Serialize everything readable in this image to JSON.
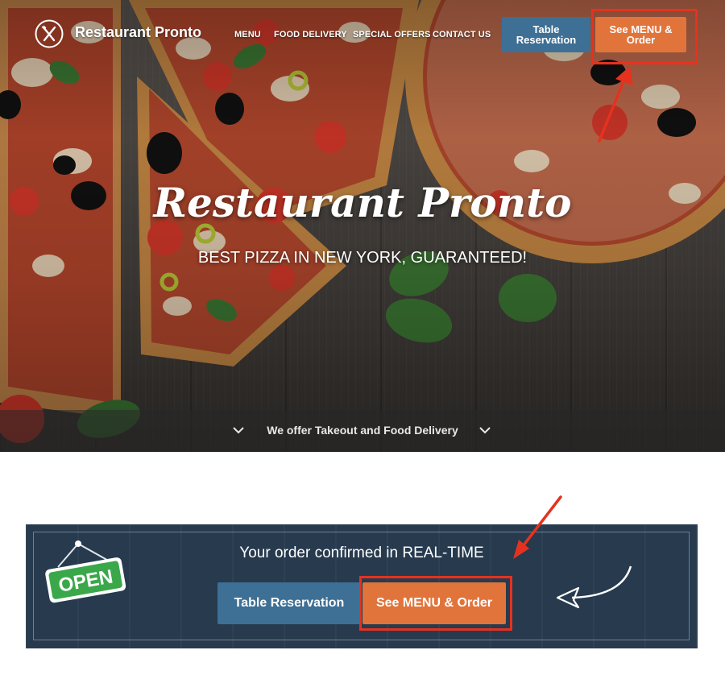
{
  "header": {
    "brand": "Restaurant Pronto",
    "nav": [
      "MENU",
      "FOOD DELIVERY",
      "SPECIAL OFFERS",
      "CONTACT US"
    ],
    "reservation_button": "Table Reservation",
    "menu_button": "See MENU & Order"
  },
  "hero": {
    "title": "Restaurant Pronto",
    "subtitle": "BEST PIZZA IN NEW YORK, GUARANTEED!",
    "info_bar": "We offer Takeout and Food Delivery"
  },
  "promo": {
    "title": "Your order confirmed in REAL-TIME",
    "sign_text": "OPEN",
    "reservation_button": "Table Reservation",
    "menu_button": "See MENU & Order"
  },
  "colors": {
    "accent_orange": "#e1743b",
    "accent_blue": "#3e6f95",
    "annotation_red": "#e5321f",
    "banner_navy": "#273a4e",
    "open_green": "#3aa84a"
  },
  "icons": [
    "restaurant-logo-icon",
    "chevron-down-icon",
    "open-sign-icon",
    "red-arrow-icon",
    "curved-arrow-icon"
  ]
}
